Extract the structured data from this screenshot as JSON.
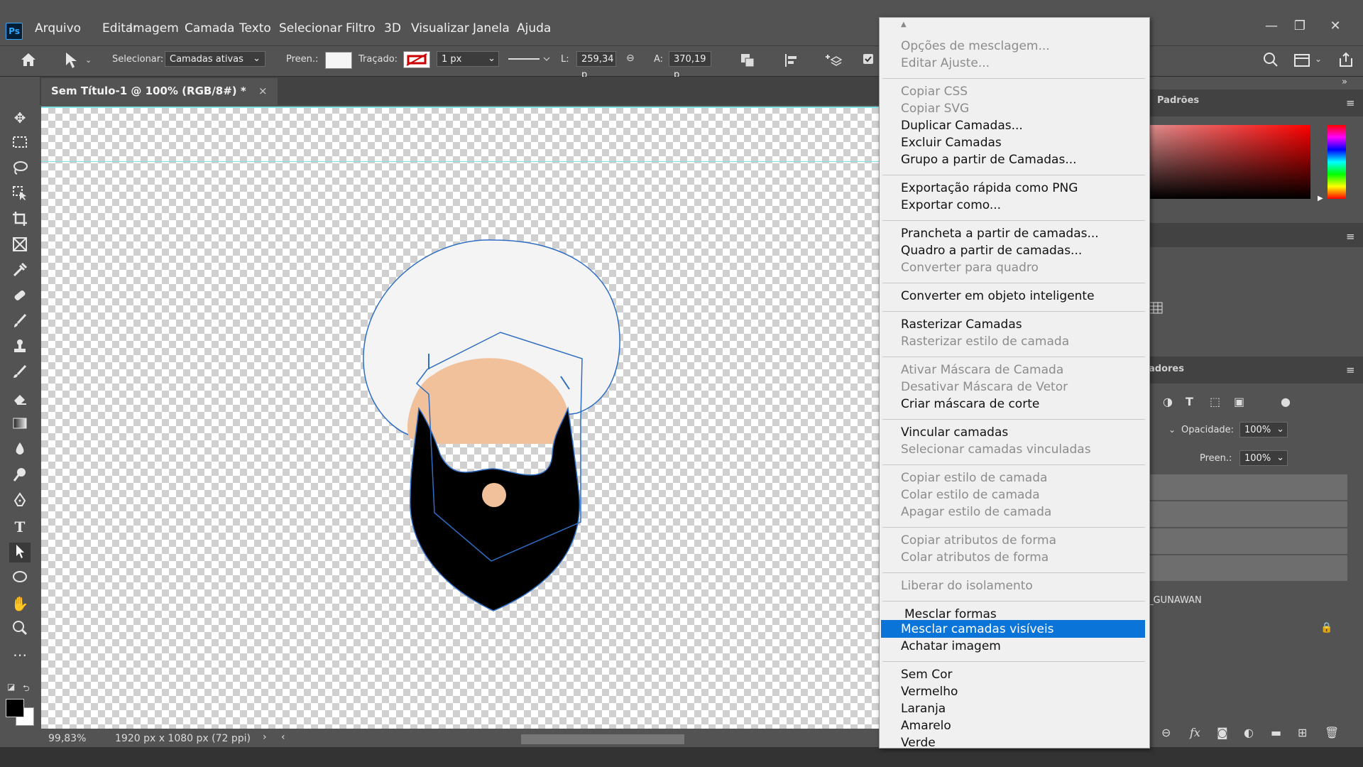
{
  "app": {
    "logo": "Ps"
  },
  "menu": [
    "Arquivo",
    "Editar",
    "Imagem",
    "Camada",
    "Texto",
    "Selecionar",
    "Filtro",
    "3D",
    "Visualizar",
    "Janela",
    "Ajuda"
  ],
  "window_controls": {
    "minimize": "—",
    "restore": "❐",
    "close": "✕"
  },
  "options_bar": {
    "select_label": "Selecionar:",
    "select_value": "Camadas ativas",
    "fill_label": "Preen.:",
    "stroke_label": "Traçado:",
    "stroke_width": "1 px",
    "width_label": "L:",
    "width_value": "259,34 p",
    "height_label": "A:",
    "height_value": "370,19 p"
  },
  "document_tab": {
    "title": "Sem Título-1 @ 100% (RGB/8#) *",
    "close": "×"
  },
  "status": {
    "zoom": "99,83%",
    "dimensions": "1920 px x 1080 px (72 ppi)"
  },
  "panels": {
    "swatches_tab": "Padrões",
    "layers_tab": "adores",
    "opacity_label": "Opacidade:",
    "opacity_value": "100%",
    "fill_label": "Preen.:",
    "fill_value": "100%",
    "layer_name": "_GUNAWAN"
  },
  "context_menu": {
    "scroll_up": "▲",
    "items": [
      {
        "label": "Opções de mesclagem...",
        "enabled": false
      },
      {
        "label": "Editar Ajuste...",
        "enabled": false
      },
      {
        "label": "Copiar CSS",
        "enabled": false
      },
      {
        "label": "Copiar SVG",
        "enabled": false
      },
      {
        "label": "Duplicar Camadas...",
        "enabled": true
      },
      {
        "label": "Excluir Camadas",
        "enabled": true
      },
      {
        "label": "Grupo a partir de Camadas...",
        "enabled": true
      },
      {
        "label": "Exportação rápida como PNG",
        "enabled": true
      },
      {
        "label": "Exportar como...",
        "enabled": true
      },
      {
        "label": "Prancheta a partir de camadas...",
        "enabled": true
      },
      {
        "label": "Quadro a partir de camadas...",
        "enabled": true
      },
      {
        "label": "Converter para quadro",
        "enabled": false
      },
      {
        "label": "Converter em objeto inteligente",
        "enabled": true
      },
      {
        "label": "Rasterizar Camadas",
        "enabled": true
      },
      {
        "label": "Rasterizar estilo de camada",
        "enabled": false
      },
      {
        "label": "Ativar Máscara de Camada",
        "enabled": false
      },
      {
        "label": "Desativar Máscara de Vetor",
        "enabled": false
      },
      {
        "label": "Criar máscara de corte",
        "enabled": true
      },
      {
        "label": "Vincular camadas",
        "enabled": true
      },
      {
        "label": "Selecionar camadas vinculadas",
        "enabled": false
      },
      {
        "label": "Copiar estilo de camada",
        "enabled": false
      },
      {
        "label": "Colar estilo de camada",
        "enabled": false
      },
      {
        "label": "Apagar estilo de camada",
        "enabled": false
      },
      {
        "label": "Copiar atributos de forma",
        "enabled": false
      },
      {
        "label": "Colar atributos de forma",
        "enabled": false
      },
      {
        "label": "Liberar do isolamento",
        "enabled": false
      },
      {
        "label": "Mesclar formas",
        "enabled": true
      },
      {
        "label": "Mesclar camadas visíveis",
        "enabled": true,
        "highlighted": true
      },
      {
        "label": "Achatar imagem",
        "enabled": true
      },
      {
        "label": "Sem Cor",
        "enabled": true
      },
      {
        "label": "Vermelho",
        "enabled": true
      },
      {
        "label": "Laranja",
        "enabled": true
      },
      {
        "label": "Amarelo",
        "enabled": true
      },
      {
        "label": "Verde",
        "enabled": true
      }
    ]
  },
  "colors": {
    "highlight": "#0a74d9",
    "face": "#f0c19b",
    "beard": "#000000",
    "turban": "#f4f4f4",
    "path": "#2e6dc2"
  }
}
